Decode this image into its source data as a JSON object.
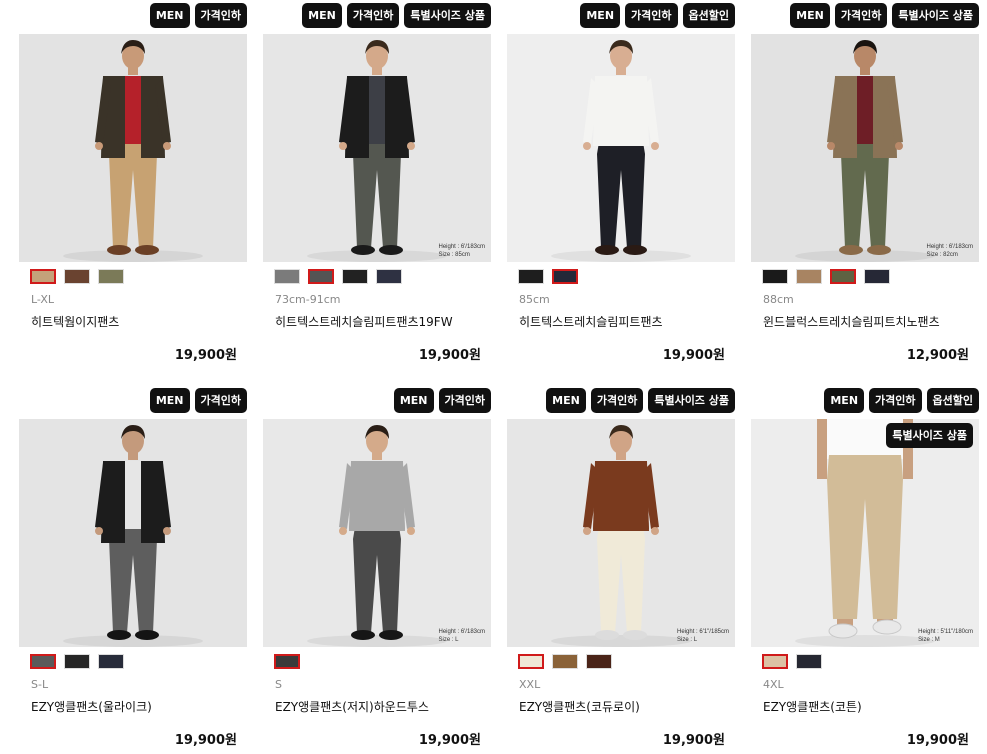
{
  "products": [
    {
      "badges": [
        "MEN",
        "가격인하"
      ],
      "bg": "#e3e3e3",
      "model": {
        "top": "#3a3328",
        "pants": "#c7a272",
        "shoes": "#6b4026",
        "skin": "#c89a78",
        "hair": "#2a1e16",
        "accent": "#b5212a",
        "jacket": true
      },
      "note": [],
      "inner_badge": "",
      "swatches": [
        {
          "color": "#c4a27a",
          "selected": true
        },
        {
          "color": "#6a4330",
          "selected": false
        },
        {
          "color": "#7b7a58",
          "selected": false
        }
      ],
      "size": "L-XL",
      "name": "히트텍웜이지팬츠",
      "price": "19,900원"
    },
    {
      "badges": [
        "MEN",
        "가격인하",
        "특별사이즈 상품"
      ],
      "bg": "#e6e6e6",
      "model": {
        "top": "#1c1c1c",
        "pants": "#545750",
        "shoes": "#1a1a1a",
        "skin": "#d4a98a",
        "hair": "#3a2a1c",
        "accent": "#3d3f46",
        "jacket": true
      },
      "note": [
        "Height : 6'/183cm",
        "Size : 85cm"
      ],
      "inner_badge": "",
      "swatches": [
        {
          "color": "#7b7b7b",
          "selected": false
        },
        {
          "color": "#545454",
          "selected": true
        },
        {
          "color": "#222222",
          "selected": false
        },
        {
          "color": "#2e3142",
          "selected": false
        }
      ],
      "size": "73cm-91cm",
      "name": "히트텍스트레치슬림피트팬츠19FW",
      "price": "19,900원"
    },
    {
      "badges": [
        "MEN",
        "가격인하",
        "옵션할인"
      ],
      "bg": "#eeeeee",
      "model": {
        "top": "#f4f4f2",
        "pants": "#1e1f26",
        "shoes": "#2a1a14",
        "skin": "#d8ae92",
        "hair": "#3a2a1c",
        "accent": "#f4f4f2",
        "jacket": false
      },
      "note": [],
      "inner_badge": "",
      "swatches": [
        {
          "color": "#1e1e1e",
          "selected": false
        },
        {
          "color": "#242838",
          "selected": true
        }
      ],
      "size": "85cm",
      "name": "히트텍스트레치슬림피트팬츠",
      "price": "19,900원"
    },
    {
      "badges": [
        "MEN",
        "가격인하",
        "특별사이즈 상품"
      ],
      "bg": "#e2e2e2",
      "model": {
        "top": "#8a7356",
        "pants": "#626a4e",
        "shoes": "#8a6a48",
        "skin": "#b88868",
        "hair": "#1a1410",
        "accent": "#6e1e26",
        "jacket": true
      },
      "note": [
        "Height : 6'/183cm",
        "Size : 82cm"
      ],
      "inner_badge": "",
      "swatches": [
        {
          "color": "#1a1a1a",
          "selected": false
        },
        {
          "color": "#a88462",
          "selected": false
        },
        {
          "color": "#5e6242",
          "selected": true
        },
        {
          "color": "#262836",
          "selected": false
        }
      ],
      "size": "88cm",
      "name": "윈드블럭스트레치슬림피트치노팬츠",
      "price": "12,900원"
    },
    {
      "badges": [
        "MEN",
        "가격인하"
      ],
      "bg": "#e4e4e4",
      "model": {
        "top": "#1c1c1c",
        "pants": "#5e5e5e",
        "shoes": "#141414",
        "skin": "#c49a7c",
        "hair": "#2a1e16",
        "accent": "#e6e6e6",
        "jacket": true
      },
      "note": [],
      "inner_badge": "",
      "swatches": [
        {
          "color": "#5a5a5a",
          "selected": true
        },
        {
          "color": "#262626",
          "selected": false
        },
        {
          "color": "#282c3a",
          "selected": false
        }
      ],
      "size": "S-L",
      "name": "EZY앵클팬츠(울라이크)",
      "price": "19,900원"
    },
    {
      "badges": [
        "MEN",
        "가격인하"
      ],
      "bg": "#e8e8e8",
      "model": {
        "top": "#a8a8a8",
        "pants": "#4a4a4a",
        "shoes": "#161616",
        "skin": "#d4aa8a",
        "hair": "#2a1e16",
        "accent": "#a8a8a8",
        "jacket": false
      },
      "note": [
        "Height : 6'/183cm",
        "Size : L"
      ],
      "inner_badge": "",
      "swatches": [
        {
          "color": "#3a3a3a",
          "selected": true
        }
      ],
      "size": "S",
      "name": "EZY앵클팬츠(저지)하운드투스",
      "price": "19,900원"
    },
    {
      "badges": [
        "MEN",
        "가격인하",
        "특별사이즈 상품"
      ],
      "bg": "#e6e6e6",
      "model": {
        "top": "#7a3a1e",
        "pants": "#f0ead8",
        "shoes": "#dcdcdc",
        "skin": "#d0a486",
        "hair": "#3a2a1c",
        "accent": "#7a3a1e",
        "jacket": false
      },
      "note": [
        "Height : 6'1\"/185cm",
        "Size : L"
      ],
      "inner_badge": "",
      "swatches": [
        {
          "color": "#efe7d6",
          "selected": true
        },
        {
          "color": "#8a6238",
          "selected": false
        },
        {
          "color": "#4a2418",
          "selected": false
        }
      ],
      "size": "XXL",
      "name": "EZY앵클팬츠(코듀로이)",
      "price": "19,900원"
    },
    {
      "badges": [
        "MEN",
        "가격인하",
        "옵션할인"
      ],
      "bg": "#ededed",
      "model": {
        "top": "#fafafa",
        "pants": "#d2bc98",
        "shoes": "#e8e8e8",
        "skin": "#c8a080",
        "hair": "#3a2a1c",
        "accent": "#fafafa",
        "jacket": false,
        "crop": true
      },
      "note": [
        "Height : 5'11\"/180cm",
        "Size : M"
      ],
      "inner_badge": "특별사이즈 상품",
      "swatches": [
        {
          "color": "#dcc2a4",
          "selected": true
        },
        {
          "color": "#262832",
          "selected": false
        }
      ],
      "size": "4XL",
      "name": "EZY앵클팬츠(코튼)",
      "price": "19,900원"
    }
  ]
}
